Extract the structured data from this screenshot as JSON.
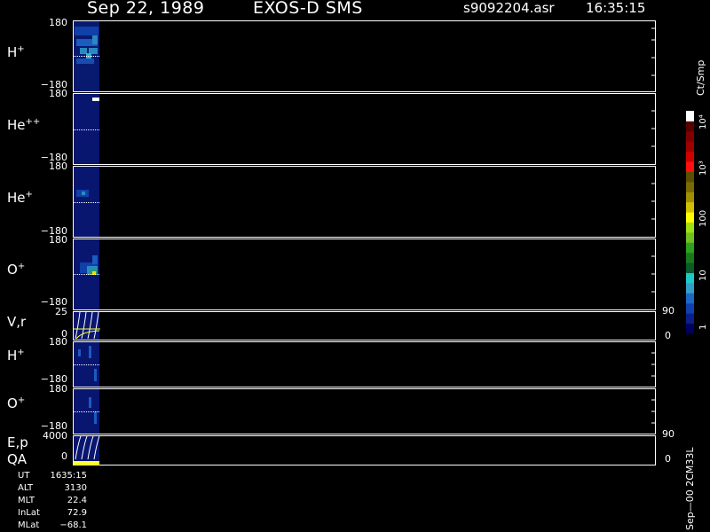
{
  "header": {
    "date": "Sep 22, 1989",
    "mission": "EXOS-D SMS",
    "file": "s9092204.asr",
    "time": "16:35:15"
  },
  "panels": [
    {
      "id": "hplus-top",
      "label_base": "H",
      "label_sup": "+",
      "ymax": "180",
      "ymin": "−180"
    },
    {
      "id": "hepp",
      "label_base": "He",
      "label_sup": "++",
      "ymax": "180",
      "ymin": "−180"
    },
    {
      "id": "heplus",
      "label_base": "He",
      "label_sup": "+",
      "ymax": "180",
      "ymin": "−180"
    },
    {
      "id": "oplus",
      "label_base": "O",
      "label_sup": "+",
      "ymax": "180",
      "ymin": "−180"
    },
    {
      "id": "vr",
      "label_base": "V,r",
      "label_sup": "",
      "ymax": "25",
      "ymin": "0",
      "rmax": "90",
      "rmin": "0"
    },
    {
      "id": "hplus-bot",
      "label_base": "H",
      "label_sup": "+",
      "ymax": "180",
      "ymin": "−180"
    },
    {
      "id": "oplus-bot",
      "label_base": "O",
      "label_sup": "+",
      "ymax": "180",
      "ymin": "−180"
    },
    {
      "id": "ep",
      "label_base": "E,p",
      "label_sup": "",
      "label2": "QA",
      "ymax": "4000",
      "ymin": "0",
      "rmax": "90",
      "rmin": "0"
    }
  ],
  "colorbar": {
    "unit": "Ct/Smp",
    "ticks": [
      "1",
      "10",
      "100",
      "10³",
      "10⁴"
    ],
    "colors": [
      "#000060",
      "#0a1f8a",
      "#1040b0",
      "#1c68c8",
      "#2fa0c8",
      "#20c8c8",
      "#0a5a2a",
      "#1a7a1a",
      "#30a020",
      "#70c020",
      "#a0e010",
      "#ffff00",
      "#d0c000",
      "#a09000",
      "#7a6a00",
      "#5a5000",
      "#ff1010",
      "#d00000",
      "#a00000",
      "#800000",
      "#5a0000",
      "#ffffff"
    ]
  },
  "footer": {
    "rows": [
      {
        "key": "UT",
        "val": "1635:15"
      },
      {
        "key": "ALT",
        "val": "3130"
      },
      {
        "key": "MLT",
        "val": "22.4"
      },
      {
        "key": "InLat",
        "val": "72.9"
      },
      {
        "key": "MLat",
        "val": "−68.1"
      }
    ]
  },
  "side_note": "Sep—00 2CM33L",
  "chart_data": {
    "type": "heatmap",
    "title": "Sep 22, 1989 EXOS-D SMS",
    "panels": [
      "H+",
      "He++",
      "He+",
      "O+",
      "V,r",
      "H+",
      "O+",
      "E,p QA"
    ],
    "y_ranges": [
      [
        -180,
        180
      ],
      [
        -180,
        180
      ],
      [
        -180,
        180
      ],
      [
        -180,
        180
      ],
      [
        0,
        25
      ],
      [
        -180,
        180
      ],
      [
        -180,
        180
      ],
      [
        0,
        4000
      ]
    ],
    "colorbar_unit": "Ct/Smp",
    "colorbar_scale": "log",
    "colorbar_range": [
      1,
      10000
    ],
    "time_start": "16:35:15"
  }
}
